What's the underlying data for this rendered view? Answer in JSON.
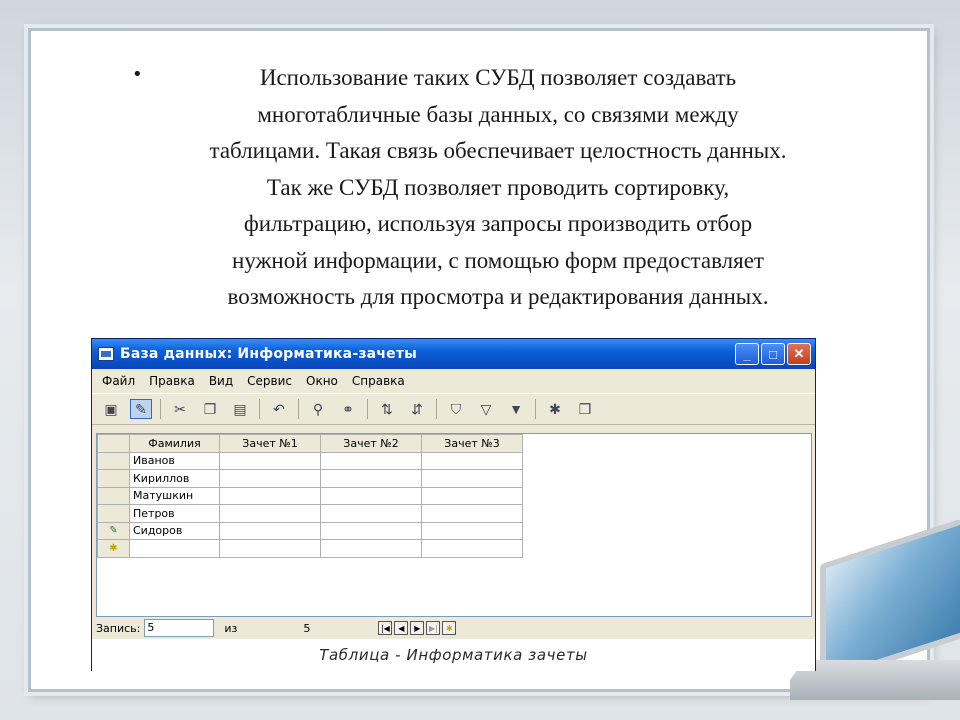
{
  "slide": {
    "bullet": "•",
    "lines": [
      "Использование таких СУБД позволяет создавать",
      "многотабличные базы данных, со связями между",
      "таблицами. Такая связь обеспечивает целостность данных.",
      "Так же СУБД позволяет проводить сортировку,",
      "фильтрацию, используя запросы производить отбор",
      "нужной информации, с помощью форм предоставляет",
      "возможность для просмотра и редактирования данных."
    ]
  },
  "window": {
    "title": "База данных: Информатика-зачеты",
    "minimize": "_",
    "maximize": "□",
    "close": "✕",
    "menu": [
      "Файл",
      "Правка",
      "Вид",
      "Сервис",
      "Окно",
      "Справка"
    ],
    "toolbar_icons": [
      "save-icon",
      "edit-icon",
      "cut-icon",
      "copy-icon",
      "paste-icon",
      "undo-icon",
      "find-icon",
      "link-icon",
      "sort-asc-icon",
      "sort-desc-icon",
      "filter-icon",
      "filter-form-icon",
      "apply-filter-icon",
      "new-record-icon",
      "database-window-icon"
    ],
    "table": {
      "headers": [
        "Фамилия",
        "Зачет №1",
        "Зачет №2",
        "Зачет №3"
      ],
      "rows": [
        {
          "selector": "",
          "name": "Иванов"
        },
        {
          "selector": "",
          "name": "Кириллов"
        },
        {
          "selector": "",
          "name": "Матушкин"
        },
        {
          "selector": "",
          "name": "Петров"
        },
        {
          "selector": "✎",
          "name": "Сидоров"
        },
        {
          "selector": "✱",
          "name": ""
        }
      ]
    },
    "status": {
      "record_label": "Запись:",
      "record_value": "5",
      "of_label": "из",
      "total": "5"
    },
    "caption": "Таблица - Информатика зачеты"
  }
}
